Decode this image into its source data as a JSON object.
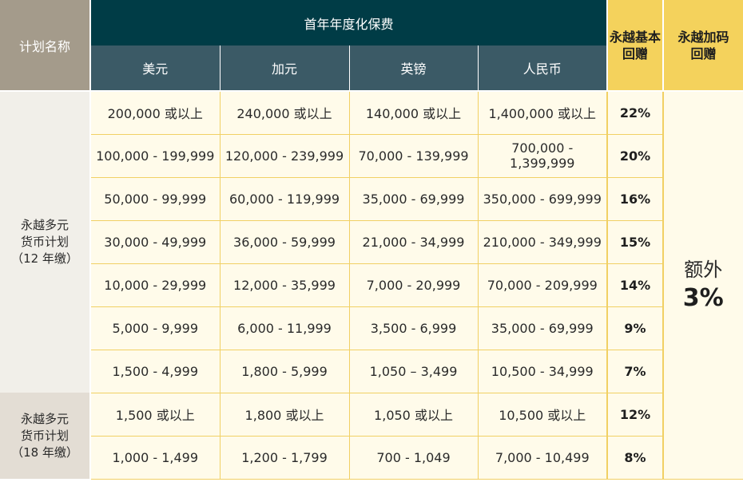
{
  "header": {
    "plan_name": "计划名称",
    "premium": "首年年度化保费",
    "currencies": [
      "美元",
      "加元",
      "英镑",
      "人民币"
    ],
    "basic_rebate": [
      "永越基本",
      "回赠"
    ],
    "bonus_rebate": [
      "永越加码",
      "回赠"
    ]
  },
  "plans": [
    {
      "name_lines": [
        "永越多元",
        "货币计划",
        "（12 年缴）"
      ]
    },
    {
      "name_lines": [
        "永越多元",
        "货币计划",
        "（18 年缴）"
      ]
    }
  ],
  "rows": [
    {
      "usd": "200,000 或以上",
      "cad": "240,000 或以上",
      "gbp": "140,000 或以上",
      "rmb": "1,400,000 或以上",
      "rate": "22%"
    },
    {
      "usd": "100,000 - 199,999",
      "cad": "120,000 - 239,999",
      "gbp": "70,000 - 139,999",
      "rmb": "700,000 - 1,399,999",
      "rate": "20%"
    },
    {
      "usd": "50,000 - 99,999",
      "cad": "60,000 - 119,999",
      "gbp": "35,000 - 69,999",
      "rmb": "350,000 - 699,999",
      "rate": "16%"
    },
    {
      "usd": "30,000 - 49,999",
      "cad": "36,000 - 59,999",
      "gbp": "21,000 - 34,999",
      "rmb": "210,000 - 349,999",
      "rate": "15%"
    },
    {
      "usd": "10,000 - 29,999",
      "cad": "12,000 - 35,999",
      "gbp": "7,000 - 20,999",
      "rmb": "70,000 - 209,999",
      "rate": "14%"
    },
    {
      "usd": "5,000 - 9,999",
      "cad": "6,000 - 11,999",
      "gbp": "3,500 - 6,999",
      "rmb": "35,000 - 69,999",
      "rate": "9%"
    },
    {
      "usd": "1,500 - 4,999",
      "cad": "1,800 - 5,999",
      "gbp": "1,050 – 3,499",
      "rmb": "10,500 - 34,999",
      "rate": "7%"
    },
    {
      "usd": "1,500 或以上",
      "cad": "1,800 或以上",
      "gbp": "1,050 或以上",
      "rmb": "10,500 或以上",
      "rate": "12%"
    },
    {
      "usd": "1,000 - 1,499",
      "cad": "1,200 - 1,799",
      "gbp": "700 - 1,049",
      "rmb": "7,000 - 10,499",
      "rate": "8%"
    }
  ],
  "bonus": {
    "word": "额外",
    "percent": "3%"
  },
  "colors": {
    "plan_header_bg": "#a49b8b",
    "premium_header_bg": "#003c46",
    "currency_header_bg": "#3b5a66",
    "rebate_header_bg": "#f4d25c",
    "cell_bg": "#fffbea",
    "cell_border": "#f1d064",
    "plan_12_bg": "#f1efe9",
    "plan_18_bg": "#e3ddd4"
  }
}
